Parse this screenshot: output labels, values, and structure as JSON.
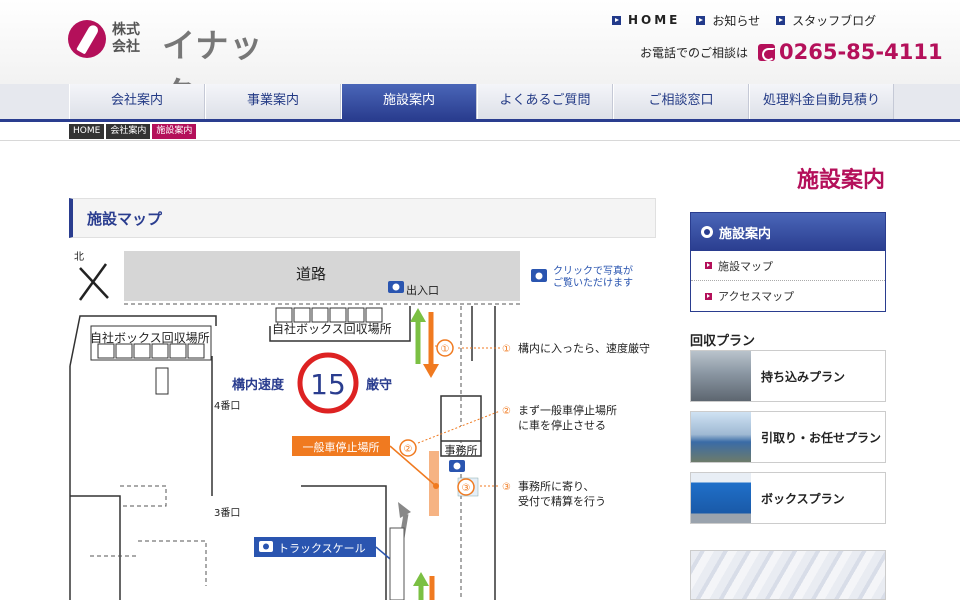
{
  "header": {
    "logo_small": "株式\n会社",
    "logo_big": "イナック",
    "links": [
      "HOME",
      "お知らせ",
      "スタッフブログ"
    ],
    "tel_label": "お電話でのご相談は",
    "tel_number": "0265-85-4111"
  },
  "nav": [
    "会社案内",
    "事業案内",
    "施設案内",
    "よくあるご質問",
    "ご相談窓口",
    "処理料金自動見積り"
  ],
  "breadcrumb": [
    "HOME",
    "会社案内",
    "施設案内"
  ],
  "page_title": "施設案内",
  "section_title": "施設マップ",
  "map": {
    "north": "北",
    "road": "道路",
    "entrance": "出入口",
    "click_note_1": "クリックで写真が",
    "click_note_2": "ご覧いただけます",
    "box_area_1": "自社ボックス回収場所",
    "box_area_2": "自社ボックス回収場所",
    "speed_left": "構内速度",
    "speed_value": "15",
    "speed_right": "厳守",
    "gate4": "4番口",
    "gate3": "3番口",
    "stop_area": "一般車停止場所",
    "office": "事務所",
    "truck_scale": "トラックスケール",
    "steps": [
      {
        "num": "①",
        "text1": "構内に入ったら、速度厳守",
        "text2": ""
      },
      {
        "num": "②",
        "text1": "まず一般車停止場所",
        "text2": "に車を停止させる"
      },
      {
        "num": "③",
        "text1": "事務所に寄り、",
        "text2": "受付で精算を行う"
      }
    ]
  },
  "sidebar": {
    "title": "施設案内",
    "items": [
      "施設マップ",
      "アクセスマップ"
    ],
    "plan_heading": "回収プラン",
    "plans": [
      "持ち込みプラン",
      "引取り・お任せプラン",
      "ボックスプラン"
    ]
  },
  "colors": {
    "brand": "#b4105a",
    "navy": "#2a3d8f",
    "orange": "#f07a20",
    "green": "#7bc043"
  }
}
